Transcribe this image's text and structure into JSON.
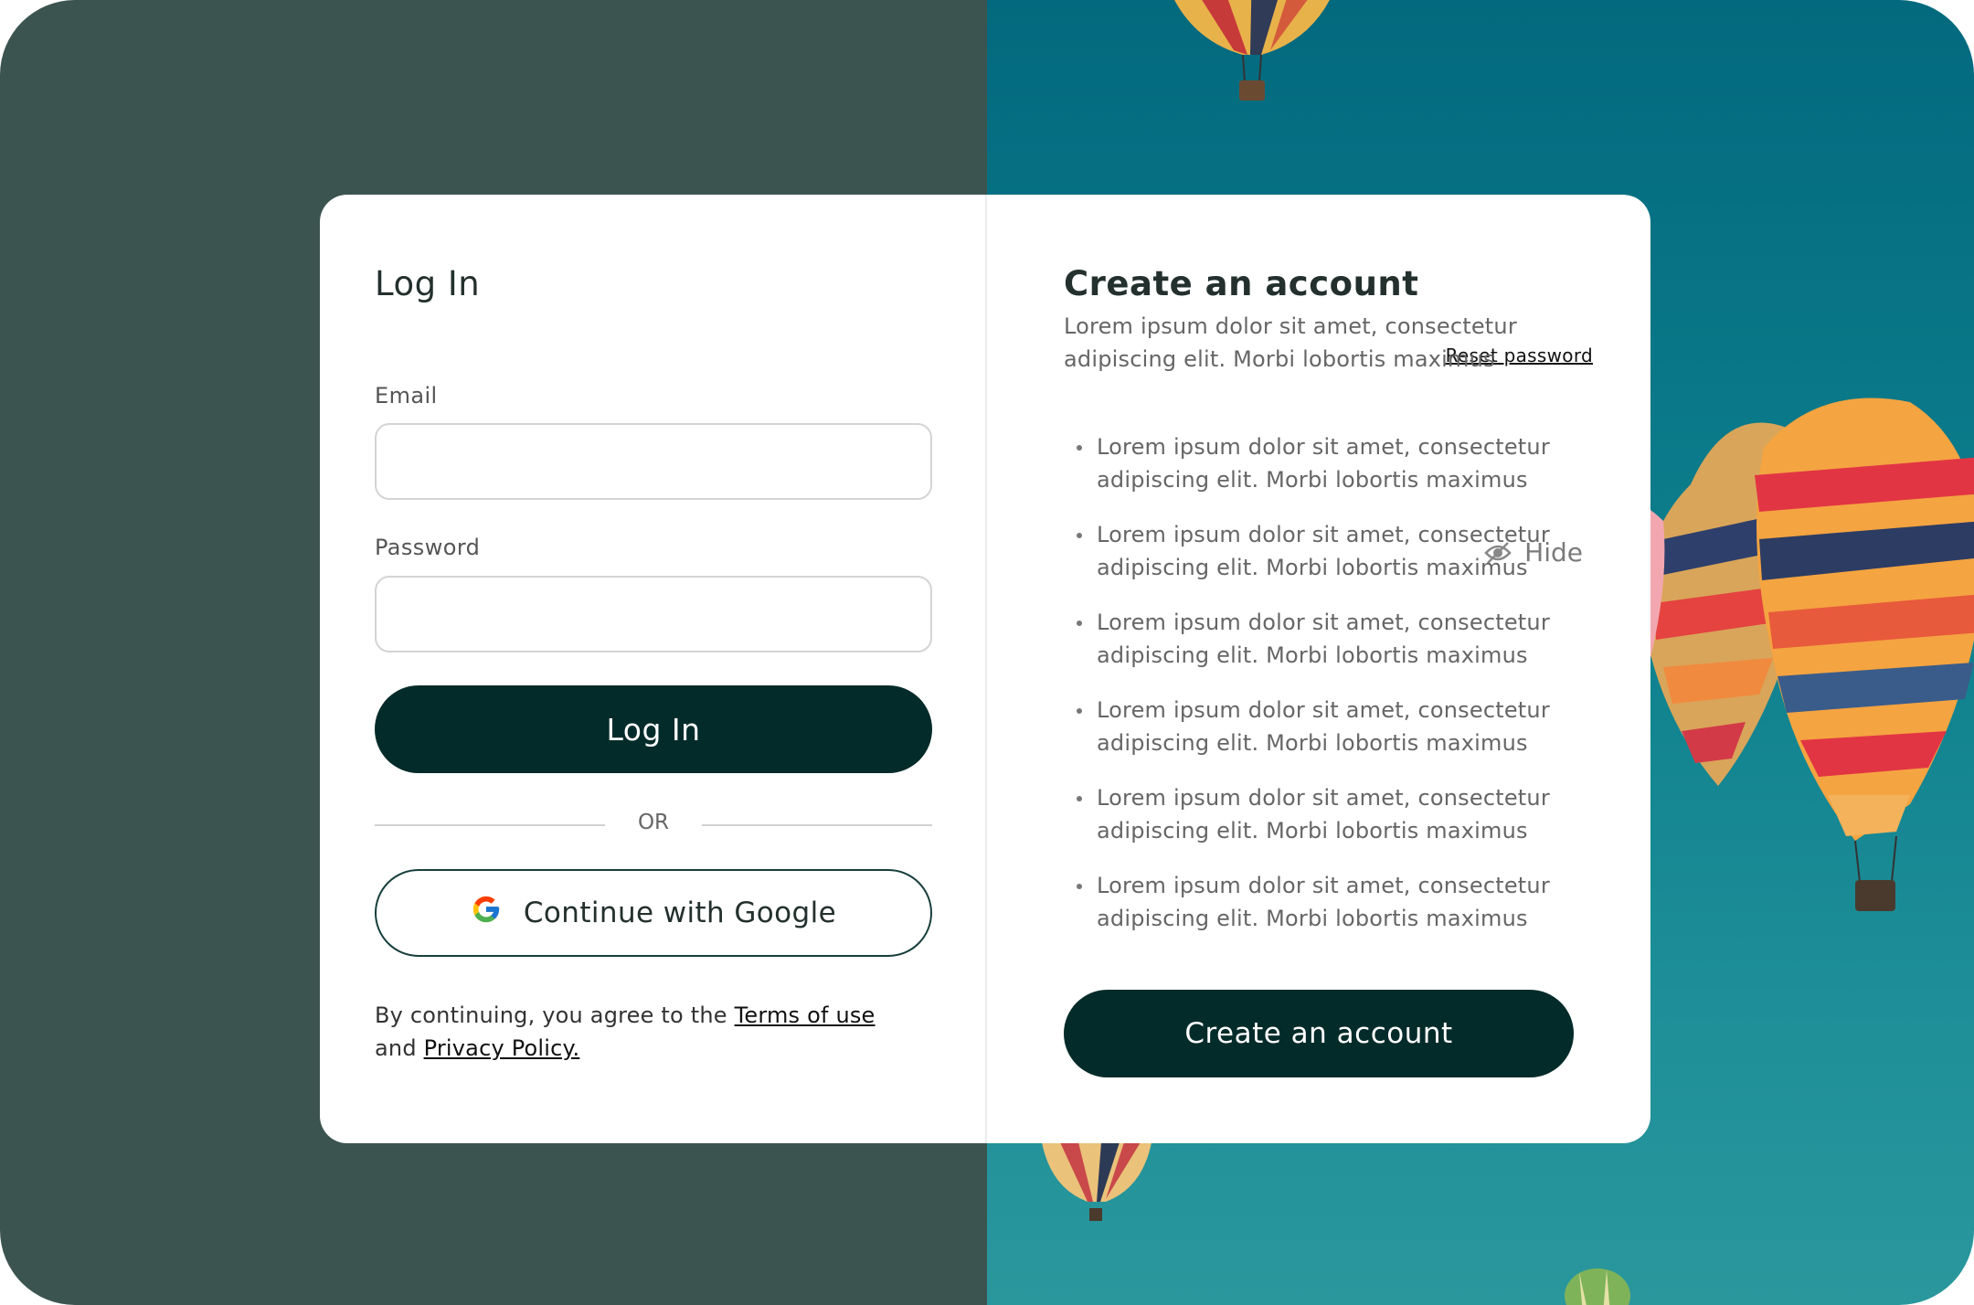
{
  "login": {
    "title": "Log In",
    "reset_label": "Reset password",
    "email_label": "Email",
    "email_value": "",
    "password_label": "Password",
    "password_value": "",
    "hide_label": "Hide",
    "submit_label": "Log In",
    "or_label": "OR",
    "google_label": "Continue with Google",
    "terms_prefix": "By continuing, you agree to the ",
    "terms_link": "Terms of use",
    "terms_and": "and ",
    "privacy_link": "Privacy Policy."
  },
  "signup": {
    "title": "Create an account",
    "description": "Lorem ipsum dolor sit amet, consectetur adipiscing elit. Morbi lobortis maximus",
    "bullets": [
      "Lorem ipsum dolor sit amet, consectetur adipiscing elit. Morbi lobortis maximus",
      "Lorem ipsum dolor sit amet, consectetur adipiscing elit. Morbi lobortis maximus",
      "Lorem ipsum dolor sit amet, consectetur adipiscing elit. Morbi lobortis maximus",
      "Lorem ipsum dolor sit amet, consectetur adipiscing elit. Morbi lobortis maximus",
      "Lorem ipsum dolor sit amet, consectetur adipiscing elit. Morbi lobortis maximus",
      "Lorem ipsum dolor sit amet, consectetur adipiscing elit. Morbi lobortis maximus"
    ],
    "button_label": "Create an account"
  },
  "icons": {
    "hide": "eye-slash-icon",
    "google": "google-icon",
    "bullet": "bullet-dot-icon"
  },
  "colors": {
    "left_background": "#3c5450",
    "right_background": "#0d7f8d",
    "primary_button": "#032b29",
    "card": "#ffffff"
  }
}
